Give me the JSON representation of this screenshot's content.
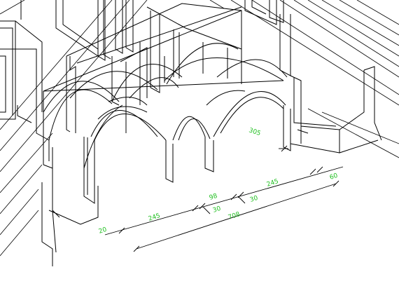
{
  "dimensions": {
    "d_305": "305",
    "d_245_right": "245",
    "d_60": "60",
    "d_98": "98",
    "d_30_a": "30",
    "d_30_b": "30",
    "d_245_left": "245",
    "d_20": "20",
    "d_708": "708"
  },
  "colors": {
    "background": "#ffffff",
    "lines": "#000000",
    "dimension_text": "#1fbf1f"
  }
}
